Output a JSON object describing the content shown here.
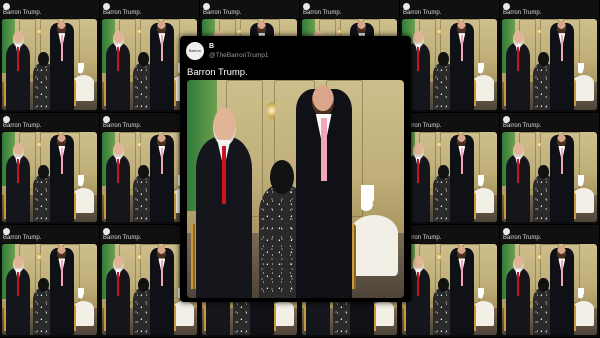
{
  "tile_template": {
    "caption": "Barron Trump."
  },
  "tweet": {
    "avatar_label": "Barron Trump",
    "display_name": "B",
    "handle": "@TheBarronTrump1",
    "text": "Barron Trump."
  },
  "icons": {
    "avatar": "profile-avatar-icon"
  }
}
